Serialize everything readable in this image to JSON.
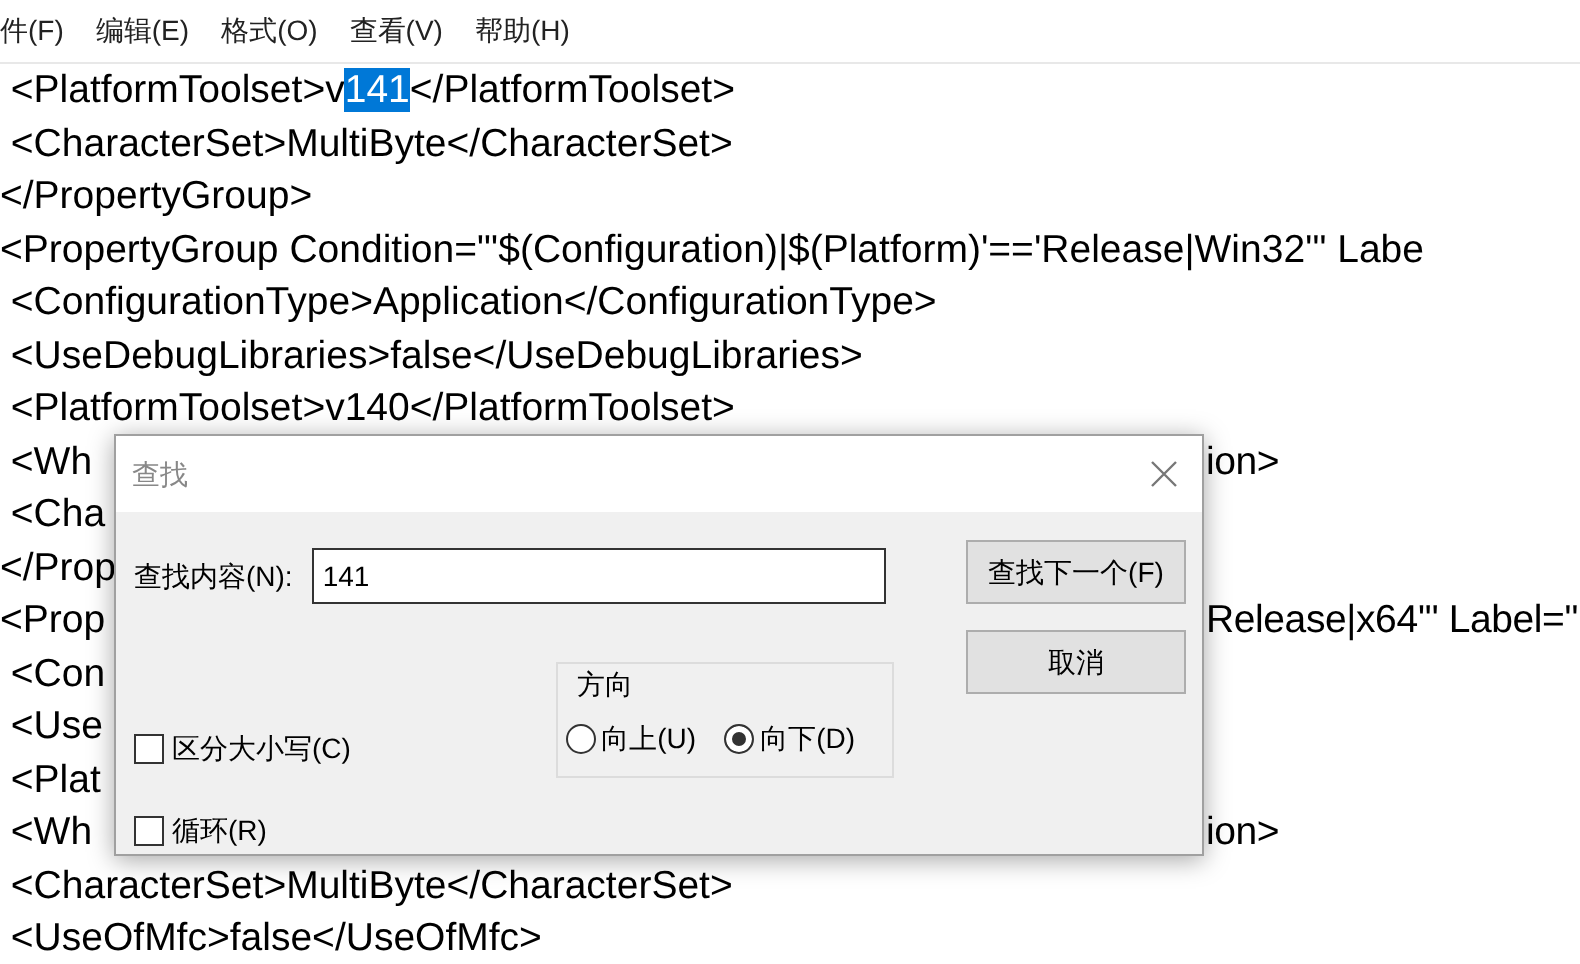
{
  "menu": [
    {
      "label": "件(F)"
    },
    {
      "label": "编辑(E)"
    },
    {
      "label": "格式(O)"
    },
    {
      "label": "查看(V)"
    },
    {
      "label": "帮助(H)"
    }
  ],
  "editor": {
    "lines": [
      {
        "segments": [
          {
            "text": " <PlatformToolset>v",
            "selected": false
          },
          {
            "text": "141",
            "selected": true
          },
          {
            "text": "</PlatformToolset>",
            "selected": false
          }
        ]
      },
      {
        "text": " <CharacterSet>MultiByte</CharacterSet>"
      },
      {
        "text": "</PropertyGroup>"
      },
      {
        "text": "<PropertyGroup Condition=\"'$(Configuration)|$(Platform)'=='Release|Win32'\" Labe"
      },
      {
        "text": " <ConfigurationType>Application</ConfigurationType>"
      },
      {
        "text": " <UseDebugLibraries>false</UseDebugLibraries>"
      },
      {
        "text": " <PlatformToolset>v140</PlatformToolset>"
      },
      {
        "text": " <Wh",
        "right": "ion>"
      },
      {
        "text": " <Cha"
      },
      {
        "text": "</Prop"
      },
      {
        "text": "<Prop",
        "right": "Release|x64'\" Label=\""
      },
      {
        "text": " <Con"
      },
      {
        "text": " <Use"
      },
      {
        "text": " <Plat"
      },
      {
        "text": " <Wh",
        "right": "ion>"
      },
      {
        "text": " <CharacterSet>MultiByte</CharacterSet>"
      },
      {
        "text": " <UseOfMfc>false</UseOfMfc>"
      }
    ]
  },
  "find_dialog": {
    "title": "查找",
    "find_label": "查找内容(N):",
    "find_value": "141",
    "options": [
      {
        "label": "区分大小写(C)",
        "checked": false
      },
      {
        "label": "循环(R)",
        "checked": false
      }
    ],
    "direction": {
      "label": "方向",
      "options": [
        {
          "label": "向上(U)",
          "selected": false
        },
        {
          "label": "向下(D)",
          "selected": true
        }
      ]
    },
    "buttons": [
      {
        "label": "查找下一个(F)"
      },
      {
        "label": "取消"
      }
    ]
  }
}
